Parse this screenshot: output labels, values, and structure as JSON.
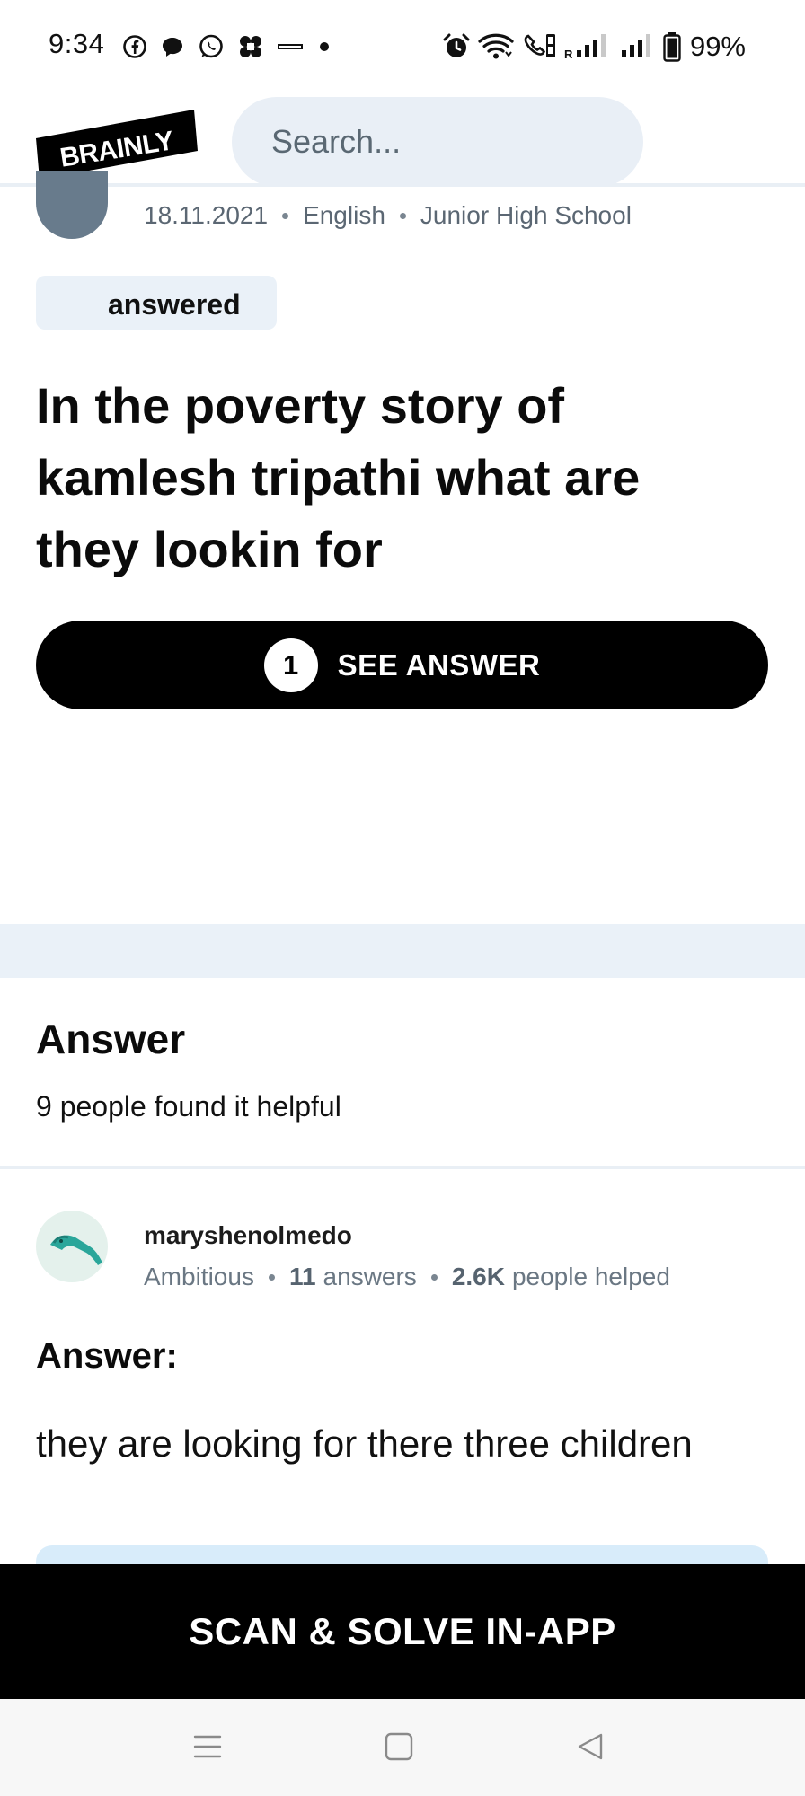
{
  "status_bar": {
    "time": "9:34",
    "battery": "99%",
    "left_icons": [
      "facebook-icon",
      "chat-bubble-icon",
      "whatsapp-icon",
      "app-grid-icon",
      "news-icon",
      "notification-dot-icon"
    ],
    "right_icons": [
      "alarm-icon",
      "wifi-icon",
      "volte-call-icon",
      "signal-roaming-icon",
      "signal-icon",
      "battery-icon"
    ]
  },
  "header": {
    "logo_text": "BRAINLY",
    "search_placeholder": "Search..."
  },
  "question": {
    "date": "18.11.2021",
    "subject": "English",
    "level": "Junior High School",
    "status_badge": "answered",
    "title": "In the poverty story of kamlesh tripathi what are they lookin for",
    "see_answer_count": "1",
    "see_answer_label": "SEE ANSWER"
  },
  "answer_section": {
    "heading": "Answer",
    "helpful": "9 people found it helpful"
  },
  "answer": {
    "username": "maryshenolmedo",
    "rank": "Ambitious",
    "answers_count": "11",
    "answers_label": "answers",
    "helped_count": "2.6K",
    "helped_label": "people helped",
    "label": "Answer:",
    "body": "they are looking for there three children"
  },
  "cta": {
    "label": "SCAN & SOLVE IN-APP"
  },
  "colors": {
    "accent_light": "#eaf1f8",
    "text_muted": "#5b6773",
    "button_dark": "#000000"
  }
}
